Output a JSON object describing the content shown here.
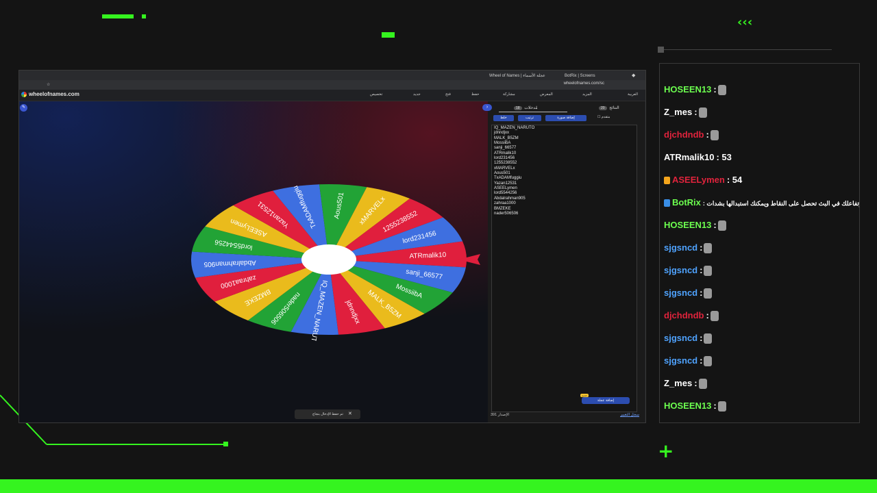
{
  "browser": {
    "tabs": [
      "Wheel of Names | عجلة الأسماء",
      "BotRix | Screens"
    ],
    "url": "wheelofnames.com/sc"
  },
  "app": {
    "logo": "wheelofnames.com",
    "menu": [
      "تخصيص",
      "جديد",
      "فتح",
      "حفظ",
      "مشاركة",
      "المعرض",
      "المزيد",
      "العربية"
    ]
  },
  "panel": {
    "tab_entries": "مُدخلات",
    "entries_count": "18",
    "tab_results": "النتائج",
    "results_count": "20",
    "tools": [
      "خلط",
      "ترتيب",
      "إضافة صورة",
      "متقدم"
    ],
    "entries": [
      "IQ_MAZEN_NARUTO",
      "jdnndjxx",
      "MALK_B5ZM",
      "MossiibA",
      "sanji_66577",
      "ATRmalik10",
      "lord231456",
      "1255238552",
      "xMARVELx",
      "Aous501",
      "TxADAMfuggiu",
      "Yazan12531",
      "ASEELymen",
      "lord5544256",
      "Abdalrahman905",
      "zahraa1000",
      "BMZEKE",
      "nader506506"
    ],
    "advanced_button": "إضافة عجلة",
    "advanced_badge": "جديد",
    "footer_version_label": "الإصدار",
    "footer_version": "391",
    "footer_link": "سجل التغيير"
  },
  "wheel": {
    "colors": [
      "#22a336",
      "#eabb1c",
      "#e01f3d",
      "#3e6fe0"
    ],
    "pointer_color": "#e01f3d",
    "segments": [
      "ATRmalik10",
      "sanji_66577",
      "MossiibA",
      "MALK_B5ZM",
      "jdnndjxx",
      "IQ_MAZEN_NARUTO",
      "nader506506",
      "BMZEKE",
      "zahraa1000",
      "Abdalrahman905",
      "lord5544256",
      "ASEELymen",
      "Yazan12531",
      "TxADAMfuggiu",
      "Aous501",
      "xMARVELx",
      "1255238552",
      "lord231456"
    ]
  },
  "toast": {
    "text": "تم حفظ الإدخال بنجاح",
    "close": "✕"
  },
  "chat": {
    "messages": [
      {
        "user": "HOSEEN13",
        "color": "#6cff4f",
        "text": ":"
      },
      {
        "user": "Z_mes",
        "color": "#ffffff",
        "text": ":"
      },
      {
        "user": "djchdndb",
        "color": "#e0233c",
        "text": ":"
      },
      {
        "user": "ATRmalik10",
        "color": "#ffffff",
        "text": ": 53"
      },
      {
        "user": "ASEELymen",
        "color": "#e0233c",
        "text": ": 54"
      },
      {
        "user": "BotRix",
        "color": "#6cff4f",
        "text": ": اثناء تواجدك وتفاعلك في البث تحصل على النقاط ويمكنك استبدالها بشدات"
      },
      {
        "user": "HOSEEN13",
        "color": "#6cff4f",
        "text": ":"
      },
      {
        "user": "sjgsncd",
        "color": "#4fa3ff",
        "text": ":"
      },
      {
        "user": "sjgsncd",
        "color": "#4fa3ff",
        "text": ":"
      },
      {
        "user": "sjgsncd",
        "color": "#4fa3ff",
        "text": ":"
      },
      {
        "user": "djchdndb",
        "color": "#e0233c",
        "text": ":"
      },
      {
        "user": "sjgsncd",
        "color": "#4fa3ff",
        "text": ":"
      },
      {
        "user": "sjgsncd",
        "color": "#4fa3ff",
        "text": ":"
      },
      {
        "user": "Z_mes",
        "color": "#ffffff",
        "text": ":"
      },
      {
        "user": "HOSEEN13",
        "color": "#6cff4f",
        "text": ":"
      }
    ]
  }
}
